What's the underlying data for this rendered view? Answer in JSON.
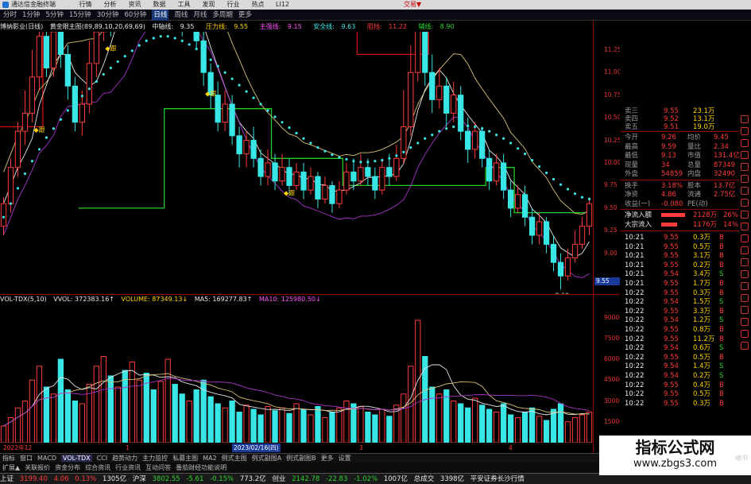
{
  "titlebar": {
    "app_title": "通达信金融终端",
    "menu": [
      "行情",
      "分析",
      "资讯",
      "数据",
      "工具",
      "发现",
      "行业",
      "热点",
      "LI12"
    ],
    "right_link": "交易▼"
  },
  "periods": [
    "分时",
    "1分钟",
    "5分钟",
    "15分钟",
    "30分钟",
    "60分钟",
    "日线",
    "周线",
    "月线",
    "多周期",
    "更多"
  ],
  "active_period": "日线",
  "legend": {
    "stock": "博纳影业(日线)",
    "formula": "黄金眼主图(89,89,10,20,69,69)",
    "mid_label": "中轴线:",
    "mid_value": "9.35",
    "pressure_label": "压力线:",
    "pressure_value": "9.55",
    "strong_label": "主强线:",
    "strong_value": "9.15",
    "safe_label": "安全线:",
    "safe_value": "9.63",
    "resist_label": "阻挡:",
    "resist_value": "11.22",
    "support_label": "辅线:",
    "support_value": "8.90",
    "high_mark": "12.73",
    "low_mark": "8.60",
    "buy_marker": "跟"
  },
  "main_axis": [
    "11.25",
    "11.00",
    "10.75",
    "10.50",
    "10.25",
    "10.00",
    "9.75",
    "9.50",
    "9.25",
    "9.00"
  ],
  "current_price_tag": "9.55",
  "vol_legend": {
    "name": "VOL-TDX(5,10)",
    "vvol": "VVOL: 372383.16↑",
    "volume": "VOLUME: 87349.13↓",
    "ma5": "MA5: 169277.83↑",
    "ma10": "MA10: 125980.50↓"
  },
  "vol_axis": [
    "90000",
    "75000",
    "60000",
    "45000",
    "30000",
    "15000"
  ],
  "dates": {
    "left": "2022年12",
    "mid1": "1",
    "highlight": "2023/02/16(四)",
    "mid2": "3",
    "mid3": "4"
  },
  "tabs": [
    "指标",
    "窗口",
    "MACD",
    "VOL-TDX",
    "CCI",
    "趋势动力",
    "主力监控",
    "私募主图",
    "MA2",
    "例式主图",
    "例式副图A",
    "例式副图B",
    "更多",
    "设置"
  ],
  "active_tab": "VOL-TDX",
  "subtabs": [
    "扩展▲",
    "关联报价",
    "资金分布",
    "综合资讯",
    "行业资讯",
    "互动问答",
    "番茄财经功能说明"
  ],
  "statusbar": {
    "sh_label": "上证",
    "sh_value": "3199.40",
    "sh_change": "4.06",
    "sh_pct": "0.13%",
    "sh_amount": "1305亿",
    "sz_label": "沪深",
    "sz_value": "3802.55",
    "sz_change": "-5.61",
    "sz_pct": "-0.15%",
    "sz_amount": "773.2亿",
    "cy_label": "创业",
    "cy_value": "2142.78",
    "cy_change": "-22.83",
    "cy_pct": "-1.02%",
    "cy_amount": "1007亿",
    "total_label": "总成交",
    "total_value": "3398亿",
    "broker": "平安证券长沙行情"
  },
  "panel": {
    "sell_levels": [
      {
        "label": "卖三",
        "price": "9.55",
        "vol": "23.1万"
      },
      {
        "label": "卖四",
        "price": "9.52",
        "vol": "13.1万"
      },
      {
        "label": "卖五",
        "price": "9.51",
        "vol": "19.0万"
      }
    ],
    "stats": [
      {
        "l1": "今开",
        "v1": "9.26",
        "l2": "均价",
        "v2": "9.45"
      },
      {
        "l1": "最高",
        "v1": "9.59",
        "l2": "量比",
        "v2": "2.34"
      },
      {
        "l1": "最低",
        "v1": "9.13",
        "l2": "市值",
        "v2": "131.4亿"
      },
      {
        "l1": "现量",
        "v1": "34",
        "l2": "总量",
        "v2": "87349"
      },
      {
        "l1": "外盘",
        "v1": "54859",
        "l2": "内盘",
        "v2": "32490"
      },
      {
        "l1": "换手",
        "v1": "3.18%",
        "l2": "股本",
        "v2": "13.7亿"
      },
      {
        "l1": "净资",
        "v1": "4.86",
        "l2": "流通",
        "v2": "2.75亿"
      },
      {
        "l1": "收益(一)",
        "v1": "-0.080",
        "l2": "PE(动)",
        "v2": ""
      }
    ],
    "flows": [
      {
        "label": "净流入额",
        "value": "2128万",
        "pct": "26%"
      },
      {
        "label": "大宗流入",
        "value": "1176万",
        "pct": "14%"
      }
    ],
    "ticks": [
      {
        "t": "10:21",
        "p": "9.55",
        "v": "0.3万",
        "s": "B"
      },
      {
        "t": "10:21",
        "p": "9.55",
        "v": "0.5万",
        "s": "B"
      },
      {
        "t": "10:21",
        "p": "9.55",
        "v": "3.1万",
        "s": "B"
      },
      {
        "t": "10:21",
        "p": "9.55",
        "v": "0.2万",
        "s": "B"
      },
      {
        "t": "10:21",
        "p": "9.54",
        "v": "3.4万",
        "s": "S"
      },
      {
        "t": "10:21",
        "p": "9.55",
        "v": "1.7万",
        "s": "B"
      },
      {
        "t": "10:22",
        "p": "9.55",
        "v": "0.3万",
        "s": "B"
      },
      {
        "t": "10:22",
        "p": "9.54",
        "v": "1.5万",
        "s": "S"
      },
      {
        "t": "10:22",
        "p": "9.55",
        "v": "3.3万",
        "s": "B"
      },
      {
        "t": "10:22",
        "p": "9.54",
        "v": "1.2万",
        "s": "S"
      },
      {
        "t": "10:22",
        "p": "9.55",
        "v": "0.8万",
        "s": "B"
      },
      {
        "t": "10:22",
        "p": "9.55",
        "v": "11.2万",
        "s": "B"
      },
      {
        "t": "10:22",
        "p": "9.54",
        "v": "0.6万",
        "s": "S"
      },
      {
        "t": "10:22",
        "p": "9.55",
        "v": "0.5万",
        "s": "B"
      },
      {
        "t": "10:22",
        "p": "9.54",
        "v": "1.4万",
        "s": "S"
      },
      {
        "t": "10:22",
        "p": "9.54",
        "v": "0.2万",
        "s": "S"
      },
      {
        "t": "10:22",
        "p": "9.55",
        "v": "0.4万",
        "s": "B"
      },
      {
        "t": "10:22",
        "p": "9.55",
        "v": "0.5万",
        "s": "B"
      },
      {
        "t": "10:22",
        "p": "9.55",
        "v": "0.3万",
        "s": "B"
      }
    ],
    "bottom_label": "图文F10",
    "bottom_right": "横书"
  },
  "watermark": {
    "line1": "指标公式网",
    "line2": "www.zbgs3.com"
  },
  "colors": {
    "up": "#ff3b3b",
    "down": "#39e6e6",
    "dotted_line": "#39e6e6",
    "step_red": "#cc1111",
    "step_green": "#22cc22",
    "ma_purple": "#aa33cc",
    "ma_yellow": "#d8c27a"
  },
  "chart_data": {
    "type": "candlestick",
    "price_range": [
      8.55,
      11.45
    ],
    "candles": [
      [
        9.3,
        9.55,
        9.2,
        9.62
      ],
      [
        9.55,
        9.95,
        9.45,
        10.05
      ],
      [
        9.95,
        10.35,
        9.85,
        10.45
      ],
      [
        10.35,
        10.55,
        10.2,
        10.8
      ],
      [
        10.55,
        10.95,
        10.45,
        11.25
      ],
      [
        10.95,
        11.4,
        10.8,
        11.85
      ],
      [
        11.4,
        11.05,
        10.95,
        11.55
      ],
      [
        11.05,
        11.45,
        10.95,
        11.7
      ],
      [
        11.45,
        11.2,
        11.05,
        11.6
      ],
      [
        11.2,
        10.85,
        10.7,
        11.3
      ],
      [
        10.85,
        10.45,
        10.35,
        10.95
      ],
      [
        10.45,
        10.65,
        10.3,
        10.8
      ],
      [
        10.65,
        11.1,
        10.55,
        11.35
      ],
      [
        11.1,
        11.45,
        10.95,
        11.6
      ],
      [
        11.45,
        11.8,
        11.35,
        12.1
      ],
      [
        11.8,
        11.55,
        11.4,
        11.95
      ],
      [
        11.55,
        11.95,
        11.45,
        12.15
      ],
      [
        11.95,
        11.65,
        11.5,
        12.05
      ],
      [
        11.65,
        11.85,
        11.5,
        12.2
      ],
      [
        11.85,
        12.25,
        11.75,
        12.45
      ],
      [
        12.25,
        12.05,
        11.9,
        12.55
      ],
      [
        12.05,
        11.7,
        11.6,
        12.2
      ],
      [
        11.7,
        11.95,
        11.55,
        12.3
      ],
      [
        11.95,
        12.35,
        11.8,
        12.73
      ],
      [
        12.35,
        11.95,
        11.85,
        12.5
      ],
      [
        11.95,
        11.55,
        11.4,
        12.05
      ],
      [
        11.55,
        11.75,
        11.45,
        11.9
      ],
      [
        11.75,
        11.35,
        11.25,
        11.85
      ],
      [
        11.35,
        11.0,
        10.85,
        11.45
      ],
      [
        11.0,
        10.75,
        10.6,
        11.1
      ],
      [
        10.75,
        10.45,
        10.35,
        10.9
      ],
      [
        10.45,
        10.65,
        10.35,
        10.8
      ],
      [
        10.65,
        10.3,
        10.2,
        10.75
      ],
      [
        10.3,
        10.1,
        9.95,
        10.4
      ],
      [
        10.1,
        10.25,
        9.95,
        10.35
      ],
      [
        10.25,
        10.05,
        9.95,
        10.4
      ],
      [
        10.05,
        9.85,
        9.75,
        10.15
      ],
      [
        9.85,
        10.0,
        9.75,
        10.15
      ],
      [
        10.0,
        9.8,
        9.7,
        10.1
      ],
      [
        9.8,
        9.95,
        9.75,
        10.1
      ],
      [
        9.95,
        9.75,
        9.65,
        10.05
      ],
      [
        9.75,
        9.9,
        9.7,
        10.0
      ],
      [
        9.9,
        9.7,
        9.6,
        10.0
      ],
      [
        9.7,
        9.85,
        9.65,
        9.95
      ],
      [
        9.85,
        9.6,
        9.5,
        9.9
      ],
      [
        9.6,
        9.75,
        9.55,
        9.85
      ],
      [
        9.75,
        9.55,
        9.45,
        9.8
      ],
      [
        9.55,
        9.7,
        9.5,
        9.8
      ],
      [
        9.7,
        9.9,
        9.65,
        10.0
      ],
      [
        9.9,
        9.8,
        9.7,
        10.05
      ],
      [
        9.8,
        9.95,
        9.75,
        10.1
      ],
      [
        9.95,
        9.85,
        9.75,
        10.05
      ],
      [
        9.85,
        9.7,
        9.6,
        9.95
      ],
      [
        9.7,
        9.95,
        9.65,
        10.05
      ],
      [
        9.95,
        9.85,
        9.75,
        10.1
      ],
      [
        9.85,
        10.05,
        9.8,
        10.2
      ],
      [
        10.05,
        10.4,
        10.0,
        10.8
      ],
      [
        10.4,
        11.0,
        10.3,
        11.3
      ],
      [
        11.0,
        11.6,
        10.9,
        12.35
      ],
      [
        11.6,
        11.0,
        10.85,
        11.8
      ],
      [
        11.0,
        10.7,
        10.55,
        11.2
      ],
      [
        10.7,
        10.85,
        10.6,
        11.05
      ],
      [
        10.85,
        10.55,
        10.4,
        10.95
      ],
      [
        10.55,
        10.75,
        10.45,
        10.9
      ],
      [
        10.75,
        10.35,
        10.25,
        10.85
      ],
      [
        10.35,
        10.15,
        10.0,
        10.5
      ],
      [
        10.15,
        10.35,
        10.05,
        10.45
      ],
      [
        10.35,
        10.05,
        9.95,
        10.4
      ],
      [
        10.05,
        9.8,
        9.7,
        10.15
      ],
      [
        9.8,
        10.0,
        9.75,
        10.1
      ],
      [
        10.0,
        9.7,
        9.6,
        10.1
      ],
      [
        9.7,
        9.5,
        9.4,
        9.8
      ],
      [
        9.5,
        9.65,
        9.45,
        9.75
      ],
      [
        9.65,
        9.4,
        9.3,
        9.75
      ],
      [
        9.4,
        9.2,
        9.1,
        9.5
      ],
      [
        9.2,
        9.35,
        9.1,
        9.45
      ],
      [
        9.35,
        9.1,
        9.0,
        9.4
      ],
      [
        9.1,
        8.9,
        8.8,
        9.2
      ],
      [
        8.9,
        8.75,
        8.6,
        9.0
      ],
      [
        8.75,
        8.95,
        8.7,
        9.05
      ],
      [
        8.95,
        9.1,
        8.9,
        9.25
      ],
      [
        9.1,
        9.3,
        9.05,
        9.4
      ],
      [
        9.3,
        9.55,
        9.2,
        9.62
      ]
    ],
    "volumes": [
      12,
      18,
      25,
      30,
      45,
      55,
      40,
      35,
      60,
      38,
      30,
      28,
      42,
      55,
      62,
      48,
      40,
      52,
      58,
      45,
      50,
      38,
      44,
      60,
      42,
      35,
      30,
      38,
      45,
      33,
      28,
      25,
      30,
      22,
      27,
      24,
      20,
      26,
      23,
      25,
      21,
      28,
      24,
      20,
      26,
      18,
      22,
      25,
      30,
      28,
      26,
      22,
      20,
      24,
      19,
      27,
      35,
      55,
      88,
      62,
      40,
      35,
      38,
      30,
      28,
      25,
      32,
      27,
      24,
      22,
      28,
      20,
      18,
      22,
      25,
      19,
      16,
      24,
      28,
      15,
      18,
      20,
      22
    ],
    "ma_mid_dots": [
      9.4,
      9.55,
      9.72,
      9.88,
      10.02,
      10.15,
      10.28,
      10.38,
      10.48,
      10.58,
      10.66,
      10.74,
      10.82,
      10.9,
      10.98,
      11.05,
      11.12,
      11.18,
      11.24,
      11.3,
      11.35,
      11.38,
      11.4,
      11.4,
      11.38,
      11.35,
      11.31,
      11.26,
      11.2,
      11.14,
      11.07,
      11.0,
      10.93,
      10.86,
      10.79,
      10.72,
      10.65,
      10.58,
      10.51,
      10.45,
      10.39,
      10.33,
      10.27,
      10.22,
      10.17,
      10.13,
      10.09,
      10.06,
      10.04,
      10.02,
      10.01,
      10.01,
      10.02,
      10.03,
      10.05,
      10.08,
      10.12,
      10.17,
      10.22,
      10.27,
      10.31,
      10.35,
      10.38,
      10.4,
      10.41,
      10.41,
      10.4,
      10.38,
      10.35,
      10.31,
      10.27,
      10.22,
      10.16,
      10.1,
      10.03,
      9.96,
      9.89,
      9.82,
      9.76,
      9.71,
      9.66,
      9.62,
      9.6
    ],
    "step_red": [
      [
        0,
        10.4
      ],
      [
        6,
        10.4
      ],
      [
        6,
        11.9
      ],
      [
        50,
        11.9
      ],
      [
        50,
        11.2
      ],
      [
        60,
        11.2
      ],
      [
        60,
        11.95
      ],
      [
        64,
        11.95
      ]
    ],
    "step_green": [
      [
        11,
        9.5
      ],
      [
        23,
        9.5
      ],
      [
        23,
        10.6
      ],
      [
        38,
        10.6
      ],
      [
        38,
        10.05
      ],
      [
        48,
        10.05
      ],
      [
        48,
        9.75
      ],
      [
        68,
        9.75
      ],
      [
        68,
        9.95
      ],
      [
        72,
        9.95
      ],
      [
        72,
        9.45
      ],
      [
        82,
        9.45
      ]
    ]
  }
}
